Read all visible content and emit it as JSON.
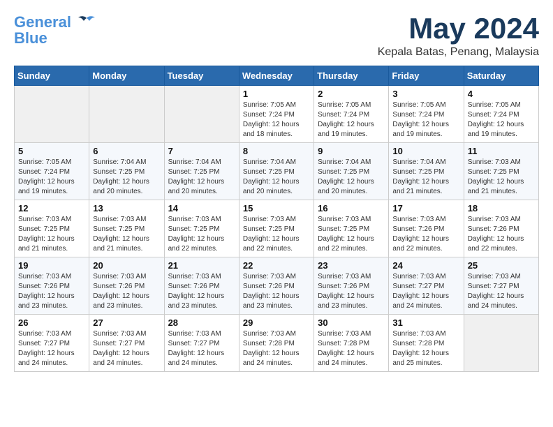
{
  "header": {
    "logo_general": "General",
    "logo_blue": "Blue",
    "month_title": "May 2024",
    "subtitle": "Kepala Batas, Penang, Malaysia"
  },
  "days_of_week": [
    "Sunday",
    "Monday",
    "Tuesday",
    "Wednesday",
    "Thursday",
    "Friday",
    "Saturday"
  ],
  "weeks": [
    [
      {
        "day": "",
        "empty": true
      },
      {
        "day": "",
        "empty": true
      },
      {
        "day": "",
        "empty": true
      },
      {
        "day": "1",
        "sunrise": "7:05 AM",
        "sunset": "7:24 PM",
        "daylight": "12 hours and 18 minutes."
      },
      {
        "day": "2",
        "sunrise": "7:05 AM",
        "sunset": "7:24 PM",
        "daylight": "12 hours and 19 minutes."
      },
      {
        "day": "3",
        "sunrise": "7:05 AM",
        "sunset": "7:24 PM",
        "daylight": "12 hours and 19 minutes."
      },
      {
        "day": "4",
        "sunrise": "7:05 AM",
        "sunset": "7:24 PM",
        "daylight": "12 hours and 19 minutes."
      }
    ],
    [
      {
        "day": "5",
        "sunrise": "7:05 AM",
        "sunset": "7:24 PM",
        "daylight": "12 hours and 19 minutes."
      },
      {
        "day": "6",
        "sunrise": "7:04 AM",
        "sunset": "7:25 PM",
        "daylight": "12 hours and 20 minutes."
      },
      {
        "day": "7",
        "sunrise": "7:04 AM",
        "sunset": "7:25 PM",
        "daylight": "12 hours and 20 minutes."
      },
      {
        "day": "8",
        "sunrise": "7:04 AM",
        "sunset": "7:25 PM",
        "daylight": "12 hours and 20 minutes."
      },
      {
        "day": "9",
        "sunrise": "7:04 AM",
        "sunset": "7:25 PM",
        "daylight": "12 hours and 20 minutes."
      },
      {
        "day": "10",
        "sunrise": "7:04 AM",
        "sunset": "7:25 PM",
        "daylight": "12 hours and 21 minutes."
      },
      {
        "day": "11",
        "sunrise": "7:03 AM",
        "sunset": "7:25 PM",
        "daylight": "12 hours and 21 minutes."
      }
    ],
    [
      {
        "day": "12",
        "sunrise": "7:03 AM",
        "sunset": "7:25 PM",
        "daylight": "12 hours and 21 minutes."
      },
      {
        "day": "13",
        "sunrise": "7:03 AM",
        "sunset": "7:25 PM",
        "daylight": "12 hours and 21 minutes."
      },
      {
        "day": "14",
        "sunrise": "7:03 AM",
        "sunset": "7:25 PM",
        "daylight": "12 hours and 22 minutes."
      },
      {
        "day": "15",
        "sunrise": "7:03 AM",
        "sunset": "7:25 PM",
        "daylight": "12 hours and 22 minutes."
      },
      {
        "day": "16",
        "sunrise": "7:03 AM",
        "sunset": "7:25 PM",
        "daylight": "12 hours and 22 minutes."
      },
      {
        "day": "17",
        "sunrise": "7:03 AM",
        "sunset": "7:26 PM",
        "daylight": "12 hours and 22 minutes."
      },
      {
        "day": "18",
        "sunrise": "7:03 AM",
        "sunset": "7:26 PM",
        "daylight": "12 hours and 22 minutes."
      }
    ],
    [
      {
        "day": "19",
        "sunrise": "7:03 AM",
        "sunset": "7:26 PM",
        "daylight": "12 hours and 23 minutes."
      },
      {
        "day": "20",
        "sunrise": "7:03 AM",
        "sunset": "7:26 PM",
        "daylight": "12 hours and 23 minutes."
      },
      {
        "day": "21",
        "sunrise": "7:03 AM",
        "sunset": "7:26 PM",
        "daylight": "12 hours and 23 minutes."
      },
      {
        "day": "22",
        "sunrise": "7:03 AM",
        "sunset": "7:26 PM",
        "daylight": "12 hours and 23 minutes."
      },
      {
        "day": "23",
        "sunrise": "7:03 AM",
        "sunset": "7:26 PM",
        "daylight": "12 hours and 23 minutes."
      },
      {
        "day": "24",
        "sunrise": "7:03 AM",
        "sunset": "7:27 PM",
        "daylight": "12 hours and 24 minutes."
      },
      {
        "day": "25",
        "sunrise": "7:03 AM",
        "sunset": "7:27 PM",
        "daylight": "12 hours and 24 minutes."
      }
    ],
    [
      {
        "day": "26",
        "sunrise": "7:03 AM",
        "sunset": "7:27 PM",
        "daylight": "12 hours and 24 minutes."
      },
      {
        "day": "27",
        "sunrise": "7:03 AM",
        "sunset": "7:27 PM",
        "daylight": "12 hours and 24 minutes."
      },
      {
        "day": "28",
        "sunrise": "7:03 AM",
        "sunset": "7:27 PM",
        "daylight": "12 hours and 24 minutes."
      },
      {
        "day": "29",
        "sunrise": "7:03 AM",
        "sunset": "7:28 PM",
        "daylight": "12 hours and 24 minutes."
      },
      {
        "day": "30",
        "sunrise": "7:03 AM",
        "sunset": "7:28 PM",
        "daylight": "12 hours and 24 minutes."
      },
      {
        "day": "31",
        "sunrise": "7:03 AM",
        "sunset": "7:28 PM",
        "daylight": "12 hours and 25 minutes."
      },
      {
        "day": "",
        "empty": true
      }
    ]
  ],
  "labels": {
    "sunrise_prefix": "Sunrise: ",
    "sunset_prefix": "Sunset: ",
    "daylight_prefix": "Daylight: "
  }
}
